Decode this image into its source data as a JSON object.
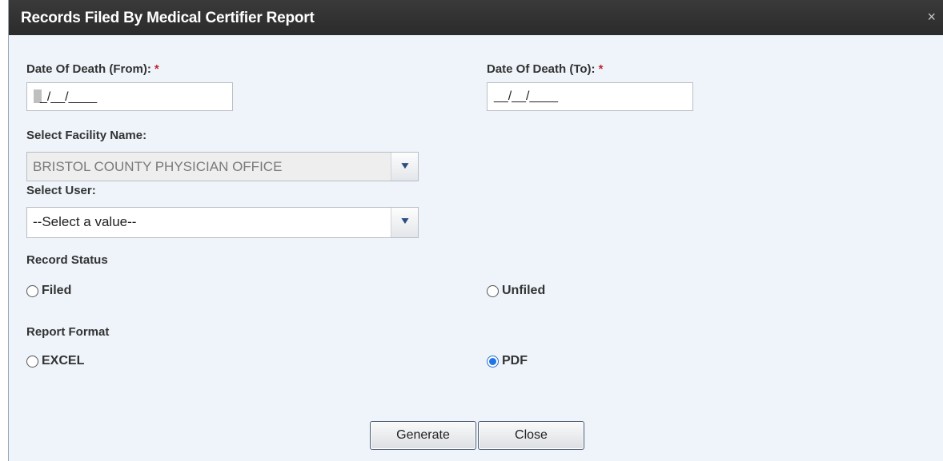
{
  "dialog": {
    "title": "Records Filed By Medical Certifier Report",
    "close_glyph": "×"
  },
  "date_from": {
    "label": "Date Of Death (From):",
    "required_mark": "*",
    "mask": "_/__/____"
  },
  "date_to": {
    "label": "Date Of Death (To):",
    "required_mark": "*",
    "mask": "__/__/____"
  },
  "facility": {
    "label": "Select Facility Name:",
    "value": "BRISTOL COUNTY PHYSICIAN OFFICE",
    "arrow": "▼"
  },
  "user": {
    "label": "Select User:",
    "value": "--Select a value--",
    "arrow": "▼"
  },
  "record_status": {
    "label": "Record Status",
    "options": [
      {
        "label": "Filed",
        "checked": false
      },
      {
        "label": "Unfiled",
        "checked": false
      }
    ]
  },
  "report_format": {
    "label": "Report Format",
    "options": [
      {
        "label": "EXCEL",
        "checked": false
      },
      {
        "label": "PDF",
        "checked": true
      }
    ]
  },
  "buttons": {
    "generate": "Generate",
    "close": "Close"
  },
  "colors": {
    "title_bar": "#2f2f2f",
    "dialog_bg": "#eef4fa",
    "required": "#c0282d",
    "radio_selected": "#1f74e6"
  }
}
